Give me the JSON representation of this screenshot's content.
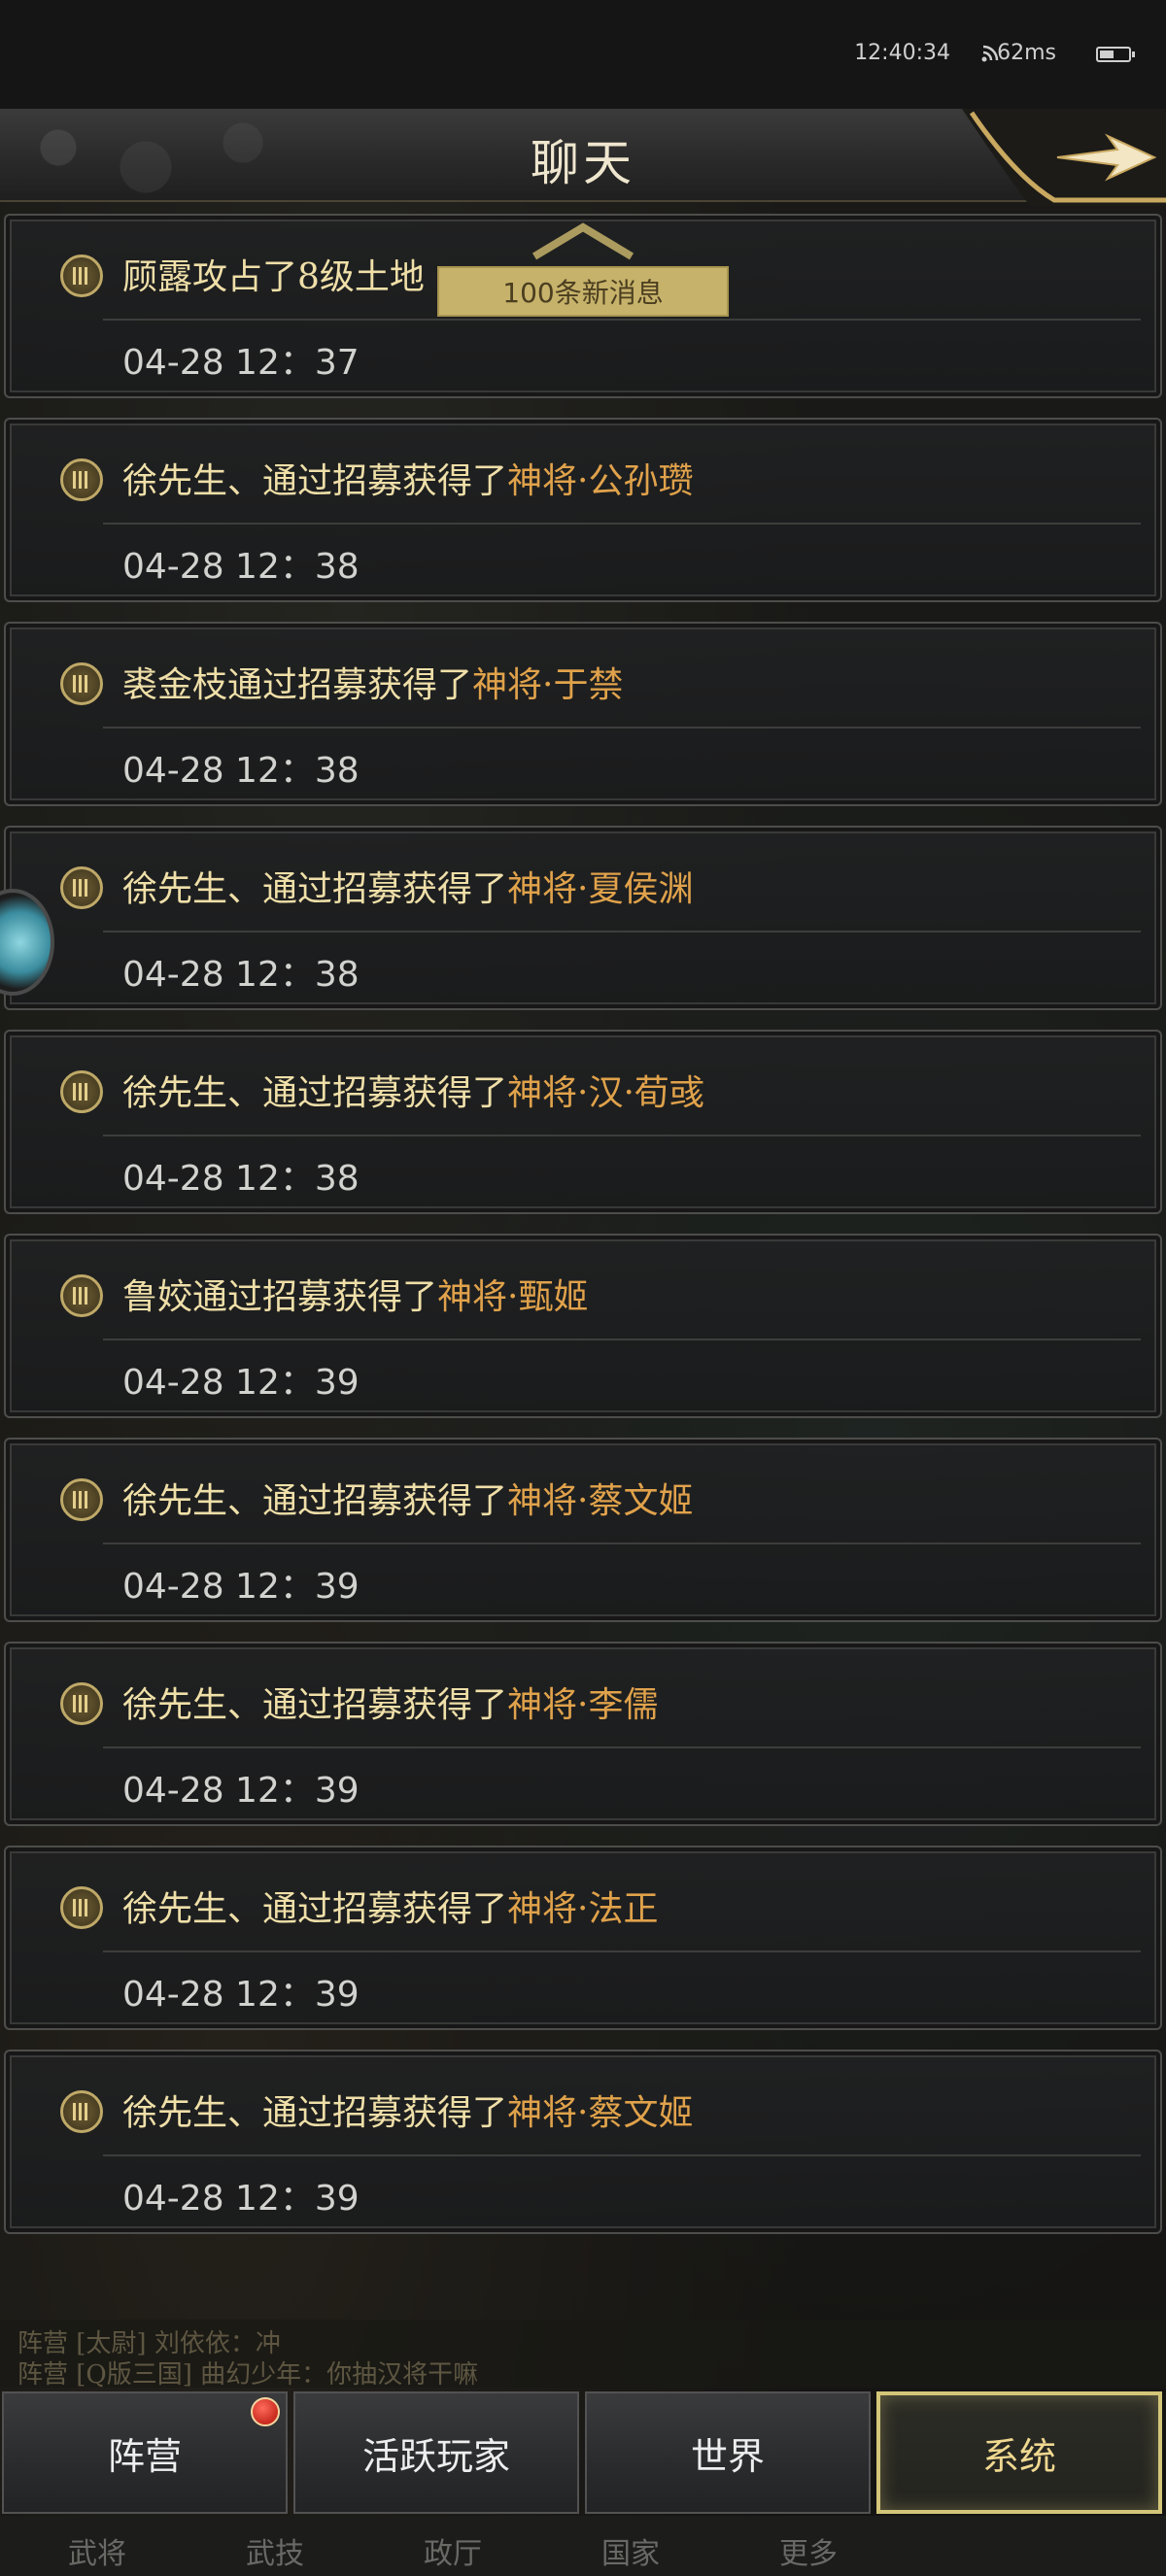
{
  "status": {
    "time": "12:40:34",
    "ping": "62ms"
  },
  "header": {
    "title": "聊天"
  },
  "banner": {
    "new_messages": "100条新消息"
  },
  "messages": [
    {
      "text": "顾露攻占了8级土地",
      "highlight": "",
      "time": "04-28 12：37"
    },
    {
      "text": "徐先生、通过招募获得了",
      "highlight": "神将·公孙瓒",
      "time": "04-28 12：38"
    },
    {
      "text": "裘金枝通过招募获得了",
      "highlight": "神将·于禁",
      "time": "04-28 12：38"
    },
    {
      "text": "徐先生、通过招募获得了",
      "highlight": "神将·夏侯渊",
      "time": "04-28 12：38"
    },
    {
      "text": "徐先生、通过招募获得了",
      "highlight": "神将·汉·荀彧",
      "time": "04-28 12：38"
    },
    {
      "text": "鲁姣通过招募获得了",
      "highlight": "神将·甄姬",
      "time": "04-28 12：39"
    },
    {
      "text": "徐先生、通过招募获得了",
      "highlight": "神将·蔡文姬",
      "time": "04-28 12：39"
    },
    {
      "text": "徐先生、通过招募获得了",
      "highlight": "神将·李儒",
      "time": "04-28 12：39"
    },
    {
      "text": "徐先生、通过招募获得了",
      "highlight": "神将·法正",
      "time": "04-28 12：39"
    },
    {
      "text": "徐先生、通过招募获得了",
      "highlight": "神将·蔡文姬",
      "time": "04-28 12：39"
    }
  ],
  "preview": {
    "line1": "阵营 [太尉] 刘依依：冲",
    "line2": "阵营 [Q版三国] 曲幻少年：你抽汉将干嘛"
  },
  "tabs": [
    {
      "label": "阵营",
      "badge": true
    },
    {
      "label": "活跃玩家",
      "badge": false
    },
    {
      "label": "世界",
      "badge": false
    },
    {
      "label": "系统",
      "badge": false,
      "active": true
    }
  ],
  "footer": [
    "武将",
    "武技",
    "政厅",
    "国家",
    "更多"
  ],
  "colors": {
    "accent_gold": "#d4c679",
    "highlight_orange": "#e0a24b",
    "text_cream": "#efdfa8"
  }
}
